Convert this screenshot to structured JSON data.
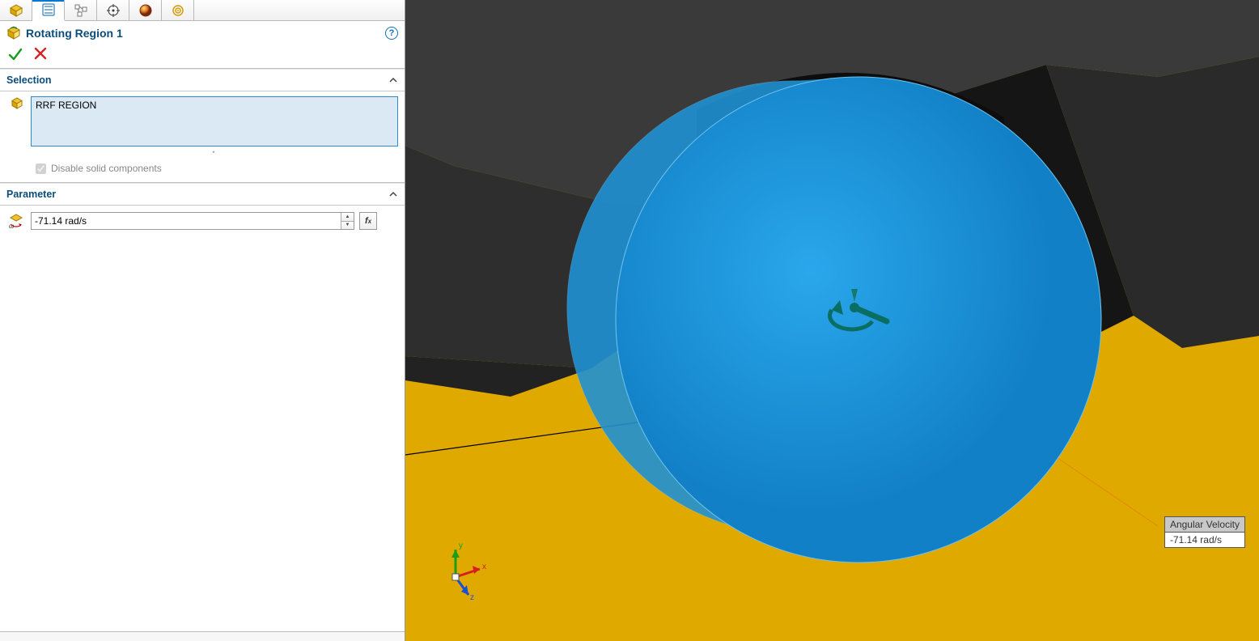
{
  "header": {
    "title": "Rotating Region 1"
  },
  "sections": {
    "selection": {
      "title": "Selection",
      "items": [
        "RRF REGION"
      ],
      "disable_solid_label": "Disable solid components",
      "disable_solid_checked": true
    },
    "parameter": {
      "title": "Parameter",
      "value": "-71.14 rad/s"
    }
  },
  "viewport": {
    "callout": {
      "title": "Angular Velocity",
      "value": "-71.14 rad/s"
    },
    "triad": {
      "x": "x",
      "y": "y",
      "z": "z"
    }
  }
}
